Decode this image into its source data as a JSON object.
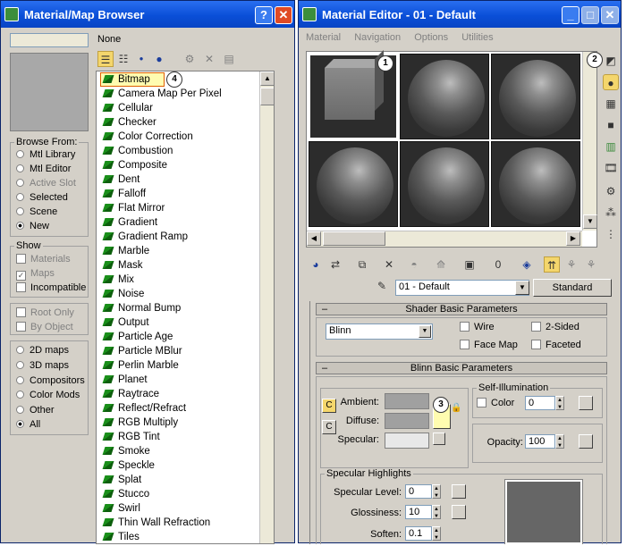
{
  "browser": {
    "title": "Material/Map Browser",
    "help_glyph": "?",
    "close_glyph": "✕",
    "name_field": "",
    "current_label": "None",
    "browse_from": {
      "legend": "Browse From:",
      "options": [
        "Mtl Library",
        "Mtl Editor",
        "Active Slot",
        "Selected",
        "Scene",
        "New"
      ]
    },
    "show": {
      "legend": "Show",
      "options": [
        "Materials",
        "Maps",
        "Incompatible"
      ]
    },
    "extra": [
      "Root Only",
      "By Object"
    ],
    "categories": [
      "2D maps",
      "3D maps",
      "Compositors",
      "Color Mods",
      "Other",
      "All"
    ],
    "maps": [
      "Bitmap",
      "Camera Map Per Pixel",
      "Cellular",
      "Checker",
      "Color Correction",
      "Combustion",
      "Composite",
      "Dent",
      "Falloff",
      "Flat Mirror",
      "Gradient",
      "Gradient Ramp",
      "Marble",
      "Mask",
      "Mix",
      "Noise",
      "Normal Bump",
      "Output",
      "Particle Age",
      "Particle MBlur",
      "Perlin Marble",
      "Planet",
      "Raytrace",
      "Reflect/Refract",
      "RGB Multiply",
      "RGB Tint",
      "Smoke",
      "Speckle",
      "Splat",
      "Stucco",
      "Swirl",
      "Thin Wall Refraction",
      "Tiles"
    ]
  },
  "editor": {
    "title": "Material Editor - 01 - Default",
    "menu": [
      "Material",
      "Navigation",
      "Options",
      "Utilities"
    ],
    "material_name": "01 - Default",
    "type_button": "Standard",
    "shader_rollout": {
      "title": "Shader Basic Parameters",
      "shader": "Blinn",
      "checks": [
        "Wire",
        "2-Sided",
        "Face Map",
        "Faceted"
      ]
    },
    "blinn_rollout": {
      "title": "Blinn Basic Parameters",
      "ambient": "Ambient:",
      "diffuse": "Diffuse:",
      "specular": "Specular:",
      "self_illum": "Self-Illumination",
      "color_label": "Color",
      "color_value": "0",
      "opacity_label": "Opacity:",
      "opacity_value": "100",
      "highlights": "Specular Highlights",
      "spec_level_label": "Specular Level:",
      "spec_level": "0",
      "glossiness_label": "Glossiness:",
      "glossiness": "10",
      "soften_label": "Soften:",
      "soften": "0.1"
    }
  },
  "callouts": [
    "1",
    "2",
    "3",
    "4"
  ],
  "colors": {
    "title_bar": "#0a4fd8",
    "close": "#e04a24",
    "highlight": "#fffcb0",
    "panel": "#d4d0c8"
  }
}
